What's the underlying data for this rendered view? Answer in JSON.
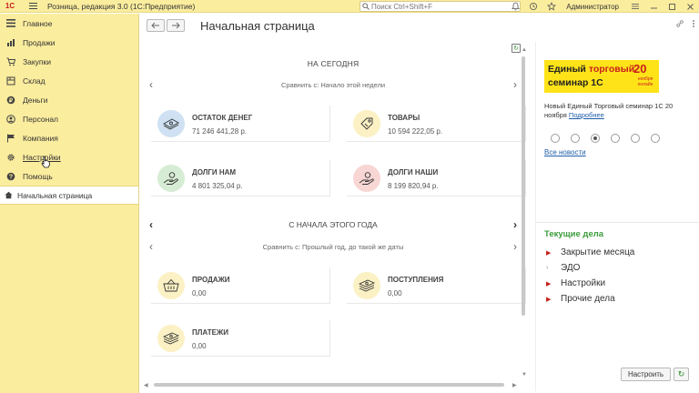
{
  "titlebar": {
    "logo": "1С",
    "app_title": "Розница, редакция 3.0  (1С:Предприятие)",
    "search_placeholder": "Поиск Ctrl+Shift+F",
    "user": "Администратор"
  },
  "sidebar": {
    "items": [
      {
        "label": "Главное",
        "icon": "menu-icon"
      },
      {
        "label": "Продажи",
        "icon": "sales-icon"
      },
      {
        "label": "Закупки",
        "icon": "purchases-icon"
      },
      {
        "label": "Склад",
        "icon": "warehouse-icon"
      },
      {
        "label": "Деньги",
        "icon": "money-icon"
      },
      {
        "label": "Персонал",
        "icon": "person-icon"
      },
      {
        "label": "Компания",
        "icon": "flag-icon"
      },
      {
        "label": "Настройки",
        "icon": "gear-icon"
      },
      {
        "label": "Помощь",
        "icon": "help-icon"
      }
    ],
    "open_page": "Начальная страница"
  },
  "header": {
    "title": "Начальная страница"
  },
  "today": {
    "title": "НА СЕГОДНЯ",
    "compare": "Сравнить с: Начало этой недели",
    "cards": [
      {
        "title": "ОСТАТОК ДЕНЕГ",
        "value": "71 246 441,28 р.",
        "icon": "money-stack-icon",
        "color": "#cfe1f3"
      },
      {
        "title": "ТОВАРЫ",
        "value": "10 594 222,05 р.",
        "icon": "price-tag-icon",
        "color": "#fbf1c4"
      },
      {
        "title": "ДОЛГИ НАМ",
        "value": "4 801 325,04 р.",
        "icon": "hand-coin-icon",
        "color": "#d6ecd4"
      },
      {
        "title": "ДОЛГИ НАШИ",
        "value": "8 199 820,94 р.",
        "icon": "hand-coin-icon",
        "color": "#f7d6d4"
      }
    ]
  },
  "year": {
    "title": "С НАЧАЛА ЭТОГО ГОДА",
    "compare": "Сравнить с: Прошлый год, до такой же даты",
    "cards": [
      {
        "title": "ПРОДАЖИ",
        "value": "0,00",
        "icon": "basket-icon",
        "color": "#fbf1c4"
      },
      {
        "title": "ПОСТУПЛЕНИЯ",
        "value": "0,00",
        "icon": "money-stack-icon",
        "color": "#fbf1c4"
      },
      {
        "title": "ПЛАТЕЖИ",
        "value": "0,00",
        "icon": "money-stack-icon",
        "color": "#fbf1c4"
      }
    ]
  },
  "news": {
    "banner_line1": "Единый",
    "banner_line1_accent": "торговый",
    "banner_line2": "семинар 1С",
    "banner_day": "20",
    "banner_month": "ноября онлайн",
    "text": "Новый Единый Торговый семинар 1С 20 ноября",
    "more_link": "Подробнее",
    "all_news": "Все новости",
    "slides": 6,
    "active_slide": 3
  },
  "tasks": {
    "title": "Текущие дела",
    "items": [
      {
        "label": "Закрытие месяца",
        "marker": "red"
      },
      {
        "label": "ЭДО",
        "marker": "gray"
      },
      {
        "label": "Настройки",
        "marker": "red"
      },
      {
        "label": "Прочие дела",
        "marker": "red"
      }
    ],
    "setup_button": "Настроить"
  },
  "colors": {
    "panel_yellow": "#fbed9e",
    "link_blue": "#1f5faa",
    "tasks_green": "#3c9b3c",
    "brand_red": "#c8201d"
  }
}
